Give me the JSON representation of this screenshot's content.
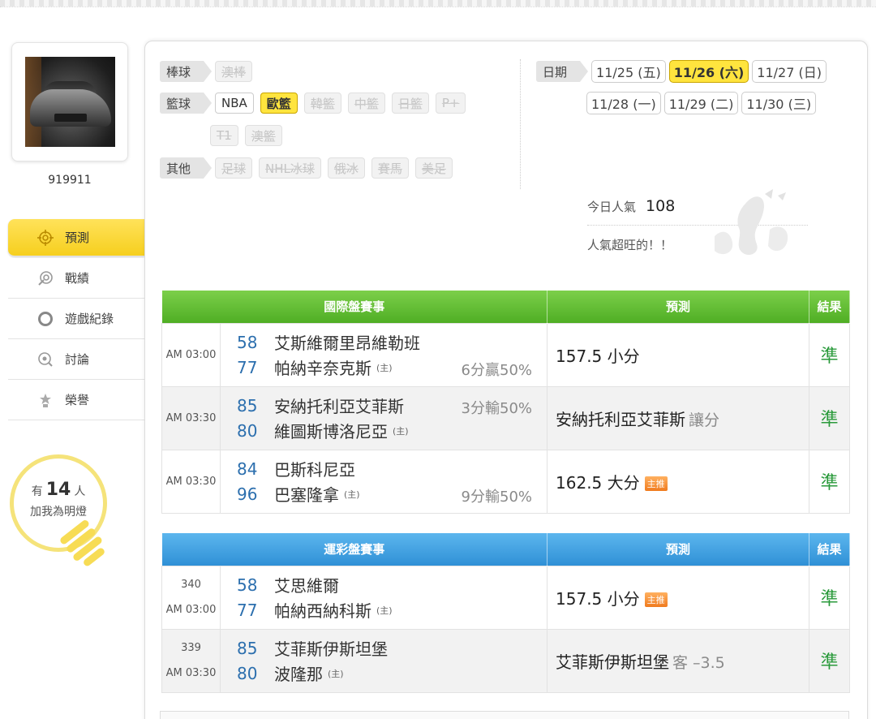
{
  "user": {
    "name": "919911"
  },
  "nav": [
    {
      "label": "預測",
      "icon": "target-icon",
      "active": true
    },
    {
      "label": "戰績",
      "icon": "record-icon",
      "active": false
    },
    {
      "label": "遊戲紀錄",
      "icon": "ring-icon",
      "active": false
    },
    {
      "label": "討論",
      "icon": "discussion-icon",
      "active": false
    },
    {
      "label": "榮譽",
      "icon": "medal-icon",
      "active": false
    }
  ],
  "fans": {
    "prefix": "有",
    "count": "14",
    "suffix": "人",
    "line2": "加我為明燈"
  },
  "categories": {
    "baseball": {
      "label": "棒球",
      "tags": [
        "澳棒"
      ]
    },
    "basketball": {
      "label": "籃球",
      "tags": [
        "NBA",
        "歐籃",
        "韓籃",
        "中籃",
        "日籃",
        "P+",
        "T1",
        "澳籃"
      ]
    },
    "other": {
      "label": "其他",
      "tags": [
        "足球",
        "NHL冰球",
        "俄冰",
        "賽馬",
        "美足"
      ]
    }
  },
  "dates": {
    "label": "日期",
    "items": [
      "11/25 (五)",
      "11/26 (六)",
      "11/27 (日)",
      "11/28 (一)",
      "11/29 (二)",
      "11/30 (三)"
    ],
    "selected": "11/26 (六)"
  },
  "popularity": {
    "label": "今日人氣",
    "value": "108",
    "note": "人氣超旺的！！"
  },
  "intl": {
    "headers": {
      "match": "國際盤賽事",
      "pred": "預測",
      "result": "結果"
    },
    "rows": [
      {
        "time": "AM 03:00",
        "s1": "58",
        "t1": "艾斯維爾里昂維勒班",
        "s2": "77",
        "t2": "帕納辛奈克斯",
        "home": "(主)",
        "handicap": "6分贏50%",
        "pred": "157.5 小分",
        "result": "準"
      },
      {
        "time": "AM 03:30",
        "s1": "85",
        "t1": "安納托利亞艾菲斯",
        "s2": "80",
        "t2": "維圖斯博洛尼亞",
        "home": "(主)",
        "handicap": "3分輸50%",
        "pred": "安納托利亞艾菲斯",
        "pred_extra": "讓分",
        "result": "準"
      },
      {
        "time": "AM 03:30",
        "s1": "84",
        "t1": "巴斯科尼亞",
        "s2": "96",
        "t2": "巴塞隆拿",
        "home": "(主)",
        "handicap": "9分輸50%",
        "pred": "162.5 大分",
        "badge": "主推",
        "result": "準"
      }
    ]
  },
  "lottery": {
    "headers": {
      "match": "運彩盤賽事",
      "pred": "預測",
      "result": "結果"
    },
    "rows": [
      {
        "num": "340",
        "time": "AM 03:00",
        "s1": "58",
        "t1": "艾思維爾",
        "s2": "77",
        "t2": "帕納西納科斯",
        "home": "(主)",
        "pred": "157.5 小分",
        "badge": "主推",
        "result": "準"
      },
      {
        "num": "339",
        "time": "AM 03:30",
        "s1": "85",
        "t1": "艾菲斯伊斯坦堡",
        "s2": "80",
        "t2": "波隆那",
        "home": "(主)",
        "pred": "艾菲斯伊斯坦堡",
        "pred_extra": "客 –3.5",
        "result": "準"
      }
    ]
  },
  "colors": {
    "accent_yellow": "#ffe43e",
    "green_header": "#4fae24",
    "blue_header": "#2f90d6",
    "win_green": "#2a9a3b",
    "score_blue": "#2c6fae"
  }
}
